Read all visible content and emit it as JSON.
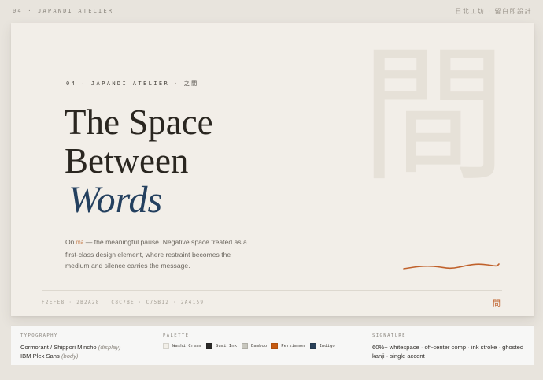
{
  "topbar": {
    "left_label": "04 · JAPANDI ATELIER",
    "right_label": "日北工坊 · 留白即設計"
  },
  "hero": {
    "ghost_kanji": "間",
    "eyebrow": {
      "number": "04",
      "name": "JAPANDI ATELIER",
      "kanji": "之間"
    },
    "headline_line1": "The Space",
    "headline_line2": "Between",
    "headline_accent": "Words",
    "lede_before": "On ",
    "lede_ma": "ma",
    "lede_after": " — the meaningful pause. Negative space treated as a first-class design element, where restraint becomes the medium and silence carries the message.",
    "hex_codes": "F2EFE8 · 2B2A28 · C8C7BE · C75B12 · 2A4159",
    "seal_glyph": "間"
  },
  "colors": {
    "background": "#e8e4dd",
    "card": "#f2eee8",
    "ink": "#2a2620",
    "indigo": "#24405f",
    "persimmon": "#c0612b"
  },
  "spec": {
    "typography": {
      "label": "TYPOGRAPHY",
      "line1_fonts": "Cormorant / Shippori Mincho",
      "line1_note": "(display)",
      "line2_fonts": "IBM Plex Sans",
      "line2_note": "(body)"
    },
    "palette": {
      "label": "PALETTE",
      "swatches": [
        {
          "name": "Washi Cream",
          "color": "#f2efe8"
        },
        {
          "name": "Sumi Ink",
          "color": "#2b2a28"
        },
        {
          "name": "Bamboo",
          "color": "#c8c7be"
        },
        {
          "name": "Persimmon",
          "color": "#c75b12"
        },
        {
          "name": "Indigo",
          "color": "#2a4159"
        }
      ]
    },
    "signature": {
      "label": "SIGNATURE",
      "text": "60%+ whitespace · off-center comp · ink stroke · ghosted kanji · single accent"
    }
  }
}
